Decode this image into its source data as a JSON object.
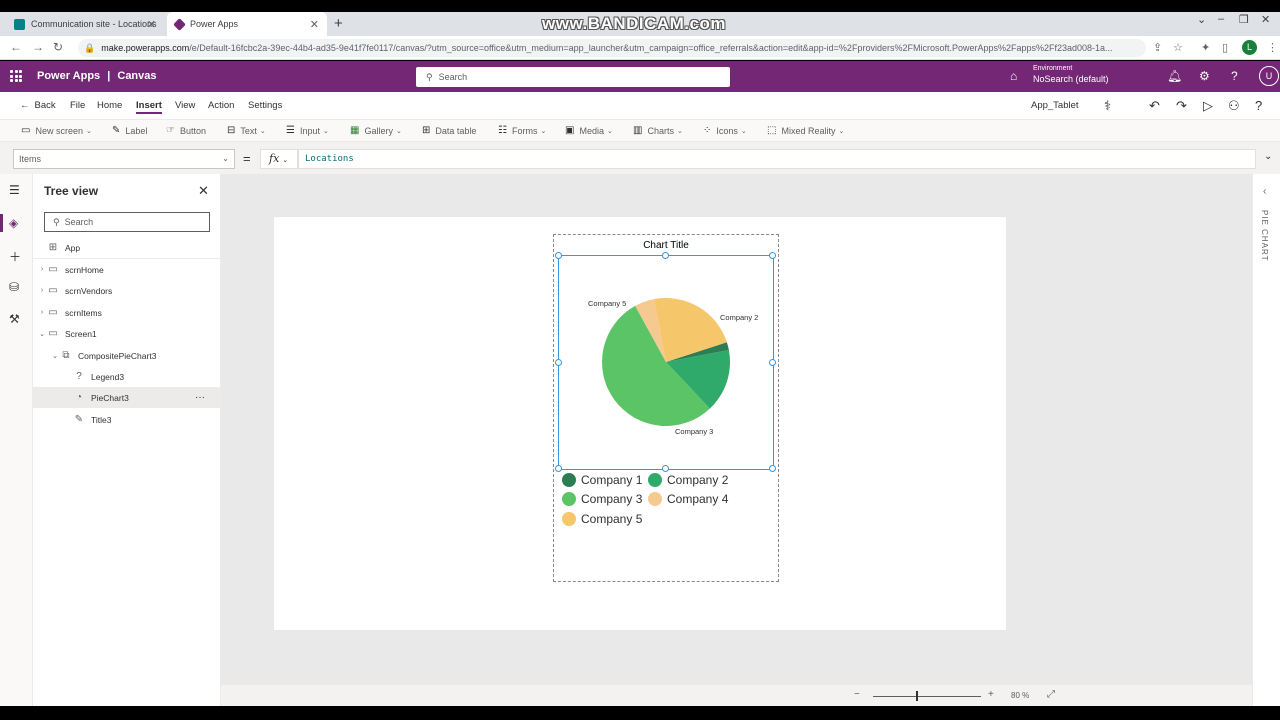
{
  "browser": {
    "tabs": [
      {
        "title": "Communication site - Locations",
        "active": false,
        "icon": "sharepoint-icon"
      },
      {
        "title": "Power Apps",
        "active": true,
        "icon": "powerapps-icon"
      }
    ],
    "watermark": "www.BANDICAM.com",
    "url_host": "make.powerapps.com",
    "url_path": "/e/Default-16fcbc2a-39ec-44b4-ad35-9e41f7fe0117/canvas/?utm_source=office&utm_medium=app_launcher&utm_campaign=office_referrals&action=edit&app-id=%2Fproviders%2FMicrosoft.PowerApps%2Fapps%2Ff23ad008-1a...",
    "profile_initial": "L"
  },
  "header": {
    "app_name": "Power Apps",
    "separator": "|",
    "section": "Canvas",
    "search_placeholder": "Search",
    "environment_label": "Environment",
    "environment_name": "NoSearch (default)",
    "user_initial": "U"
  },
  "commandbar": {
    "back": "Back",
    "menus": [
      "File",
      "Home",
      "Insert",
      "View",
      "Action",
      "Settings"
    ],
    "active_menu": "Insert",
    "app_type": "App_Tablet"
  },
  "ribbon": {
    "items": [
      "New screen",
      "Label",
      "Button",
      "Text",
      "Input",
      "Gallery",
      "Data table",
      "Forms",
      "Media",
      "Charts",
      "Icons",
      "Mixed Reality"
    ]
  },
  "formula": {
    "property": "Items",
    "equals": "=",
    "fx": "fx",
    "value": "Locations"
  },
  "tree": {
    "title": "Tree view",
    "search_placeholder": "Search",
    "items": [
      {
        "label": "App"
      },
      {
        "label": "scrnHome"
      },
      {
        "label": "scrnVendors"
      },
      {
        "label": "scrnItems"
      },
      {
        "label": "Screen1"
      },
      {
        "label": "CompositePieChart3"
      },
      {
        "label": "Legend3"
      },
      {
        "label": "PieChart3"
      },
      {
        "label": "Title3"
      }
    ],
    "selected": "PieChart3"
  },
  "properties_panel": {
    "label": "PIE CHART"
  },
  "chart_data": {
    "type": "pie",
    "title": "Chart Title",
    "categories": [
      "Company 1",
      "Company 2",
      "Company 3",
      "Company 4",
      "Company 5"
    ],
    "values": [
      2,
      16,
      54,
      5,
      23
    ],
    "colors": [
      "#2d7d54",
      "#2faa6a",
      "#5bc467",
      "#f6c990",
      "#f6c66b"
    ],
    "data_labels": [
      "",
      "Company 2",
      "Company 3",
      "",
      "Company 5"
    ],
    "legend": "bottom"
  },
  "zoom": {
    "minus": "−",
    "plus": "+",
    "percent": "80 %"
  }
}
